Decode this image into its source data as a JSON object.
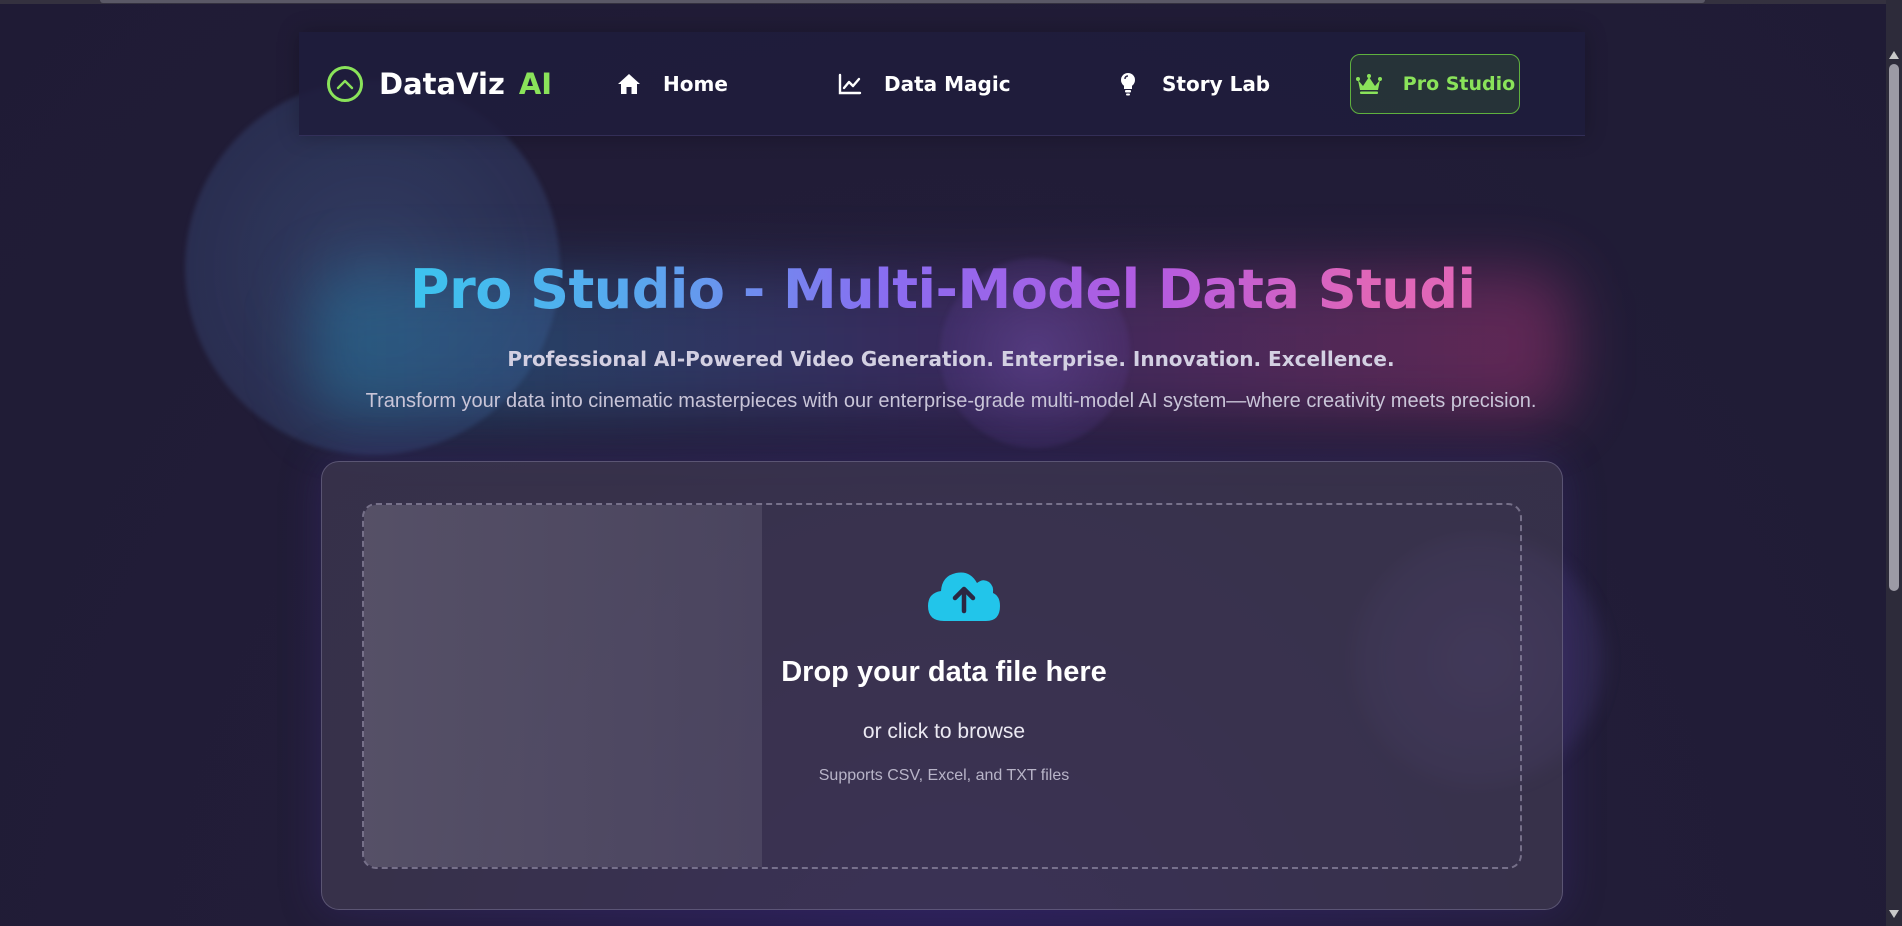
{
  "brand": {
    "name": "DataViz",
    "accent": "AI",
    "logo_icon": "chevron-up-circle-icon",
    "accent_color": "#8ae35a"
  },
  "nav": {
    "items": [
      {
        "label": "Home",
        "icon": "home-icon"
      },
      {
        "label": "Data Magic",
        "icon": "chart-line-icon"
      },
      {
        "label": "Story Lab",
        "icon": "lightbulb-icon"
      }
    ],
    "pro": {
      "label": "Pro Studio",
      "icon": "crown-icon"
    }
  },
  "hero": {
    "title": "Pro Studio - Multi-Model Data Studio",
    "subtitle": "Professional AI-Powered Video Generation. Enterprise. Innovation. Excellence.",
    "tagline": "Transform your data into cinematic masterpieces with our enterprise-grade multi-model AI system—where creativity meets precision.",
    "gradient_colors": [
      "#3cc4ee",
      "#8a6cf0",
      "#e066b8"
    ]
  },
  "upload": {
    "icon": "cloud-upload-icon",
    "icon_color": "#22c5ea",
    "title": "Drop your data file here",
    "subtitle": "or click to browse",
    "note": "Supports CSV, Excel, and TXT files"
  }
}
